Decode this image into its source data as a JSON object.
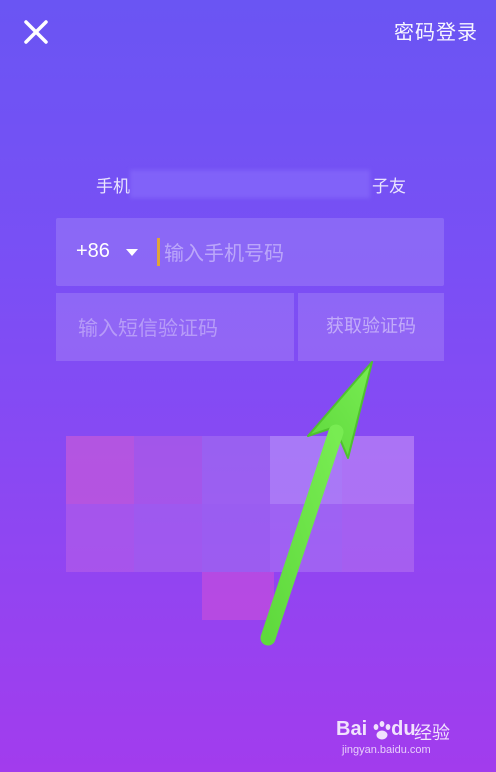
{
  "header": {
    "close_icon": "close-icon",
    "password_login_label": "密码登录"
  },
  "subtitle": {
    "left_text": "手机",
    "right_text": "子友"
  },
  "phone": {
    "country_code": "+86",
    "placeholder": "输入手机号码"
  },
  "sms": {
    "placeholder": "输入短信验证码",
    "get_code_label": "获取验证码"
  },
  "annotation": {
    "arrow_color": "#6fe24a"
  },
  "watermark": {
    "brand_a": "Bai",
    "brand_b": "du",
    "jingyan": "经验",
    "url": "jingyan.baidu.com"
  },
  "colors": {
    "gradient_top": "#6a55f3",
    "gradient_bottom": "#a23ced",
    "cursor": "#e0a43a"
  }
}
